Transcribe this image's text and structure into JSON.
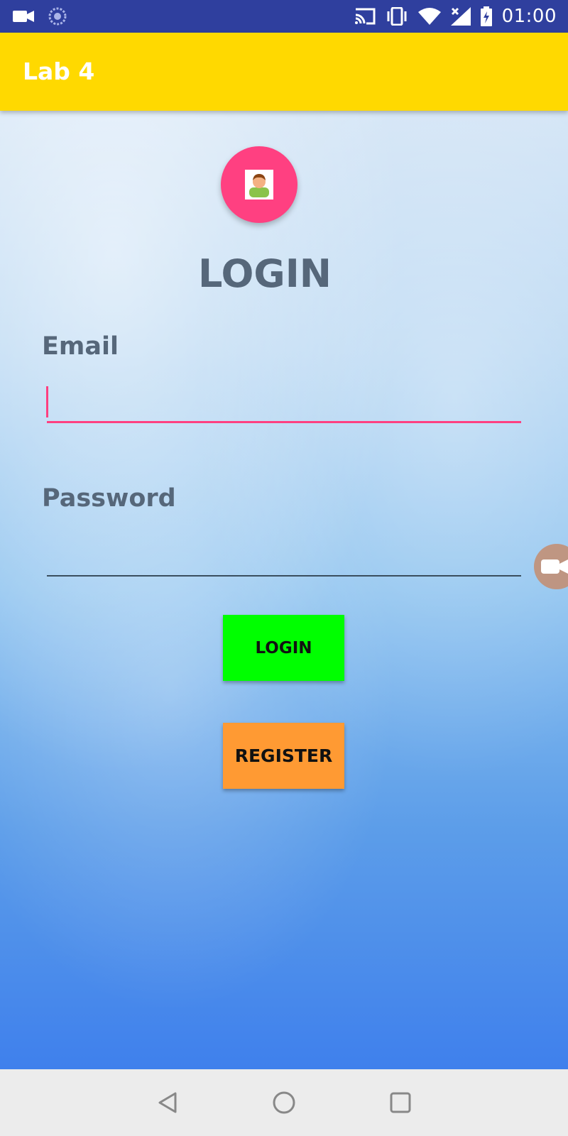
{
  "status_bar": {
    "time": "01:00",
    "icons": [
      "video-camera-icon",
      "sync-icon",
      "cast-icon",
      "vibrate-icon",
      "wifi-icon",
      "cellular-signal-icon",
      "battery-charging-icon"
    ]
  },
  "app_bar": {
    "title": "Lab 4",
    "background_color": "#ffd900"
  },
  "login_form": {
    "avatar_icon": "person-icon",
    "heading": "LOGIN",
    "email": {
      "label": "Email",
      "value": "",
      "focused": true
    },
    "password": {
      "label": "Password",
      "value": ""
    },
    "login_button_label": "LOGIN",
    "register_button_label": "REGISTER"
  },
  "floating_overlay": {
    "icon": "video-camera-icon"
  },
  "nav_bar": {
    "buttons": [
      "back-icon",
      "home-icon",
      "recents-icon"
    ]
  },
  "colors": {
    "status_bar": "#2f3f9e",
    "accent": "#ff4081",
    "login_button": "#00ff00",
    "register_button": "#ff9a33",
    "label_text": "#56677a"
  }
}
